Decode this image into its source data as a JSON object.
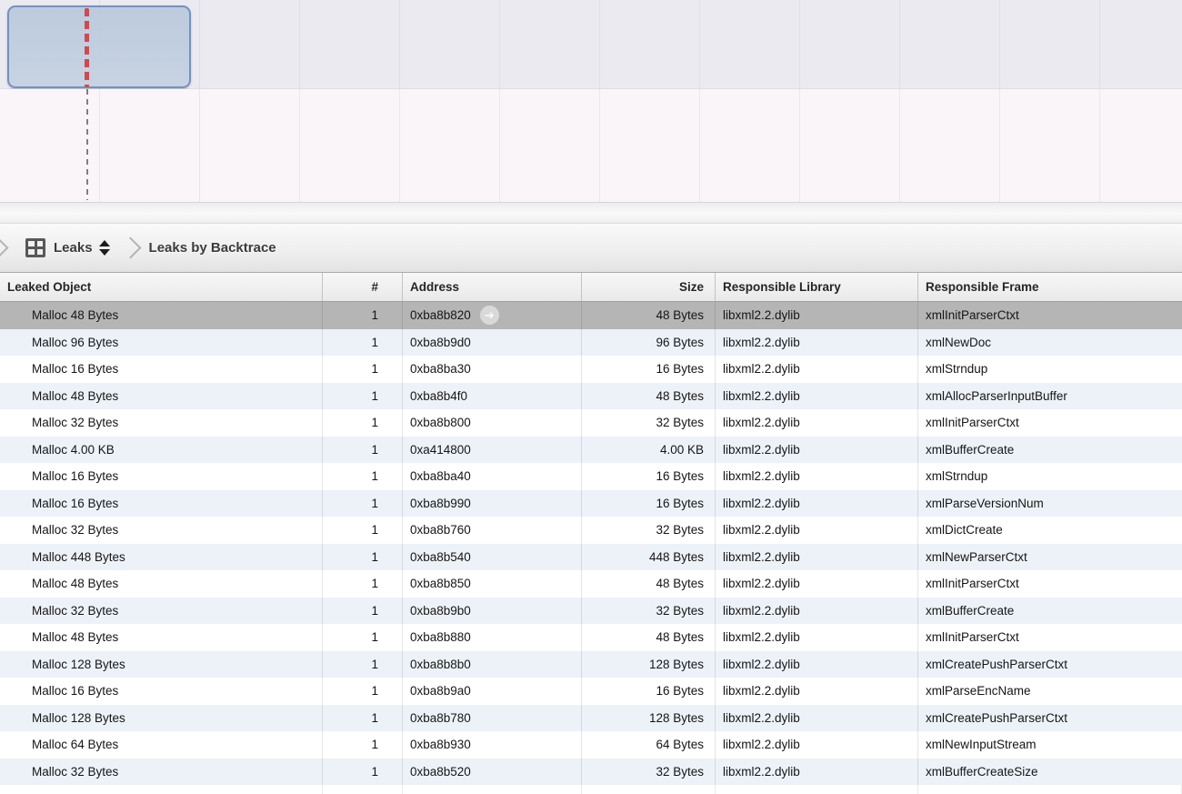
{
  "timeline": {
    "selection_label": "selected time range with leak markers",
    "colors": {
      "track_background": "#ebeaf1",
      "lower_background": "#faf5f8",
      "selection_fill": "#c6d1e0",
      "selection_border": "#7492bf",
      "leak_marker_red": "#cd4a50",
      "playhead_gray": "#7f7f7f"
    }
  },
  "breadcrumb": {
    "instrument_label": "Leaks",
    "detail_view_label": "Leaks by Backtrace"
  },
  "table": {
    "columns": [
      {
        "key": "object",
        "label": "Leaked Object"
      },
      {
        "key": "count",
        "label": "#"
      },
      {
        "key": "address",
        "label": "Address"
      },
      {
        "key": "size",
        "label": "Size"
      },
      {
        "key": "library",
        "label": "Responsible Library"
      },
      {
        "key": "frame",
        "label": "Responsible Frame"
      }
    ],
    "rows": [
      {
        "object": "Malloc 48 Bytes",
        "count": "1",
        "address": "0xba8b820",
        "size": "48 Bytes",
        "library": "libxml2.2.dylib",
        "frame": "xmlInitParserCtxt",
        "selected": true,
        "focus_arrow": true
      },
      {
        "object": "Malloc 96 Bytes",
        "count": "1",
        "address": "0xba8b9d0",
        "size": "96 Bytes",
        "library": "libxml2.2.dylib",
        "frame": "xmlNewDoc",
        "selected": false,
        "focus_arrow": false
      },
      {
        "object": "Malloc 16 Bytes",
        "count": "1",
        "address": "0xba8ba30",
        "size": "16 Bytes",
        "library": "libxml2.2.dylib",
        "frame": "xmlStrndup",
        "selected": false,
        "focus_arrow": false
      },
      {
        "object": "Malloc 48 Bytes",
        "count": "1",
        "address": "0xba8b4f0",
        "size": "48 Bytes",
        "library": "libxml2.2.dylib",
        "frame": "xmlAllocParserInputBuffer",
        "selected": false,
        "focus_arrow": false
      },
      {
        "object": "Malloc 32 Bytes",
        "count": "1",
        "address": "0xba8b800",
        "size": "32 Bytes",
        "library": "libxml2.2.dylib",
        "frame": "xmlInitParserCtxt",
        "selected": false,
        "focus_arrow": false
      },
      {
        "object": "Malloc 4.00 KB",
        "count": "1",
        "address": "0xa414800",
        "size": "4.00 KB",
        "library": "libxml2.2.dylib",
        "frame": "xmlBufferCreate",
        "selected": false,
        "focus_arrow": false
      },
      {
        "object": "Malloc 16 Bytes",
        "count": "1",
        "address": "0xba8ba40",
        "size": "16 Bytes",
        "library": "libxml2.2.dylib",
        "frame": "xmlStrndup",
        "selected": false,
        "focus_arrow": false
      },
      {
        "object": "Malloc 16 Bytes",
        "count": "1",
        "address": "0xba8b990",
        "size": "16 Bytes",
        "library": "libxml2.2.dylib",
        "frame": "xmlParseVersionNum",
        "selected": false,
        "focus_arrow": false
      },
      {
        "object": "Malloc 32 Bytes",
        "count": "1",
        "address": "0xba8b760",
        "size": "32 Bytes",
        "library": "libxml2.2.dylib",
        "frame": "xmlDictCreate",
        "selected": false,
        "focus_arrow": false
      },
      {
        "object": "Malloc 448 Bytes",
        "count": "1",
        "address": "0xba8b540",
        "size": "448 Bytes",
        "library": "libxml2.2.dylib",
        "frame": "xmlNewParserCtxt",
        "selected": false,
        "focus_arrow": false
      },
      {
        "object": "Malloc 48 Bytes",
        "count": "1",
        "address": "0xba8b850",
        "size": "48 Bytes",
        "library": "libxml2.2.dylib",
        "frame": "xmlInitParserCtxt",
        "selected": false,
        "focus_arrow": false
      },
      {
        "object": "Malloc 32 Bytes",
        "count": "1",
        "address": "0xba8b9b0",
        "size": "32 Bytes",
        "library": "libxml2.2.dylib",
        "frame": "xmlBufferCreate",
        "selected": false,
        "focus_arrow": false
      },
      {
        "object": "Malloc 48 Bytes",
        "count": "1",
        "address": "0xba8b880",
        "size": "48 Bytes",
        "library": "libxml2.2.dylib",
        "frame": "xmlInitParserCtxt",
        "selected": false,
        "focus_arrow": false
      },
      {
        "object": "Malloc 128 Bytes",
        "count": "1",
        "address": "0xba8b8b0",
        "size": "128 Bytes",
        "library": "libxml2.2.dylib",
        "frame": "xmlCreatePushParserCtxt",
        "selected": false,
        "focus_arrow": false
      },
      {
        "object": "Malloc 16 Bytes",
        "count": "1",
        "address": "0xba8b9a0",
        "size": "16 Bytes",
        "library": "libxml2.2.dylib",
        "frame": "xmlParseEncName",
        "selected": false,
        "focus_arrow": false
      },
      {
        "object": "Malloc 128 Bytes",
        "count": "1",
        "address": "0xba8b780",
        "size": "128 Bytes",
        "library": "libxml2.2.dylib",
        "frame": "xmlCreatePushParserCtxt",
        "selected": false,
        "focus_arrow": false
      },
      {
        "object": "Malloc 64 Bytes",
        "count": "1",
        "address": "0xba8b930",
        "size": "64 Bytes",
        "library": "libxml2.2.dylib",
        "frame": "xmlNewInputStream",
        "selected": false,
        "focus_arrow": false
      },
      {
        "object": "Malloc 32 Bytes",
        "count": "1",
        "address": "0xba8b520",
        "size": "32 Bytes",
        "library": "libxml2.2.dylib",
        "frame": "xmlBufferCreateSize",
        "selected": false,
        "focus_arrow": false
      }
    ]
  },
  "icons": {
    "focus_arrow_glyph": "➔"
  }
}
